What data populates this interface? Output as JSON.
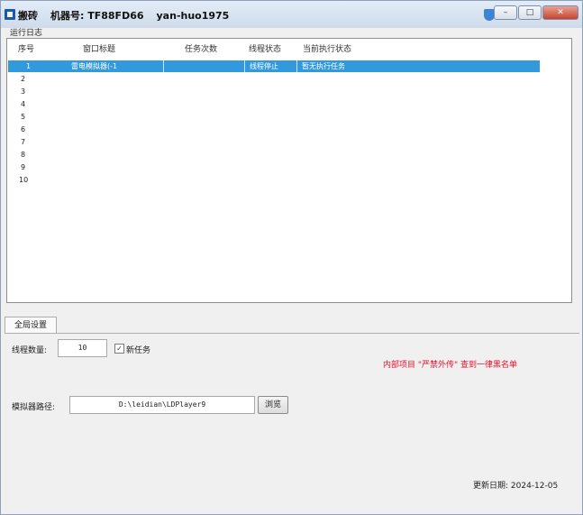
{
  "window": {
    "app_name": "搬砖",
    "machine_label": "机器号: TF88FD66",
    "user": "yan-huo1975"
  },
  "log_section": {
    "label": "运行日志"
  },
  "grid": {
    "columns": [
      "序号",
      "窗口标题",
      "任务次数",
      "线程状态",
      "当前执行状态"
    ],
    "rows": [
      {
        "num": "1",
        "title": "雷电模拟器(-1",
        "count": "",
        "status": "线程停止",
        "current": "暂无执行任务"
      },
      {
        "num": "2",
        "title": "",
        "count": "",
        "status": "",
        "current": ""
      },
      {
        "num": "3",
        "title": "",
        "count": "",
        "status": "",
        "current": ""
      },
      {
        "num": "4",
        "title": "",
        "count": "",
        "status": "",
        "current": ""
      },
      {
        "num": "5",
        "title": "",
        "count": "",
        "status": "",
        "current": ""
      },
      {
        "num": "6",
        "title": "",
        "count": "",
        "status": "",
        "current": ""
      },
      {
        "num": "7",
        "title": "",
        "count": "",
        "status": "",
        "current": ""
      },
      {
        "num": "8",
        "title": "",
        "count": "",
        "status": "",
        "current": ""
      },
      {
        "num": "9",
        "title": "",
        "count": "",
        "status": "",
        "current": ""
      },
      {
        "num": "10",
        "title": "",
        "count": "",
        "status": "",
        "current": ""
      }
    ]
  },
  "settings": {
    "tab_label": "全局设置",
    "thread_count_label": "线程数量:",
    "thread_count_value": "10",
    "checkbox_label": "新任务",
    "checkbox_checked": true,
    "checkbox_mark": "✓",
    "notice": "内部项目 \"严禁外传\" 查到一律黑名单",
    "emulator_path_label": "模拟器路径:",
    "emulator_path_value": "D:\\leidian\\LDPlayer9",
    "browse_label": "浏览",
    "update_date": "更新日期: 2024-12-05"
  }
}
